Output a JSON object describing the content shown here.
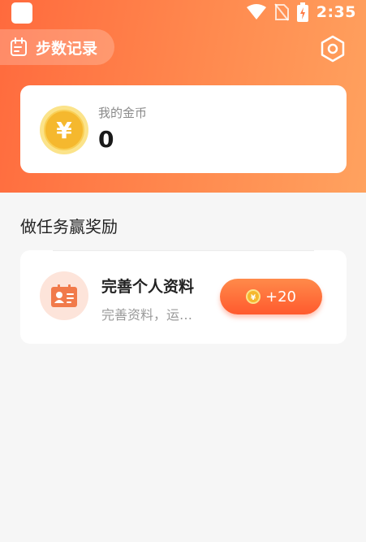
{
  "status_bar": {
    "time": "2:35"
  },
  "header": {
    "steps_label": "步数记录"
  },
  "coin_card": {
    "label": "我的金币",
    "value": "0",
    "symbol": "¥"
  },
  "section": {
    "title": "做任务赢奖励"
  },
  "tasks": [
    {
      "title": "完善个人资料",
      "desc": "完善资料，运动更科学",
      "reward": "+20",
      "coin_symbol": "¥"
    }
  ],
  "colors": {
    "accent": "#ff6a3d",
    "accent_light": "#ffa25f",
    "coin": "#f7c33a"
  }
}
